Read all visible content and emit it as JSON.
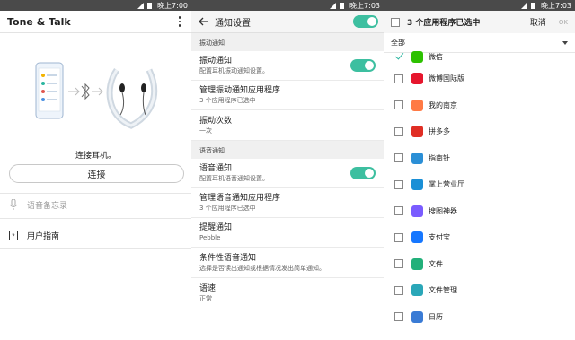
{
  "status_bars": [
    {
      "time": "晚上7:00"
    },
    {
      "time": "晚上7:03"
    },
    {
      "time": "晚上7:03"
    }
  ],
  "panel1": {
    "title": "Tone & Talk",
    "connect_prompt": "连接耳机。",
    "connect_button": "连接",
    "rows": [
      {
        "label": "语音备忘录",
        "icon": "microphone-hand-icon",
        "enabled": false
      },
      {
        "label": "用户指南",
        "icon": "help-book-icon",
        "enabled": true
      }
    ]
  },
  "panel2": {
    "title": "通知设置",
    "header_toggle": "on",
    "sections": [
      {
        "header": "振动通知",
        "items": [
          {
            "title": "振动通知",
            "subtitle": "配置耳机振动通知设置。",
            "toggle": "on"
          },
          {
            "title": "管理振动通知应用程序",
            "subtitle": "3 个应用程序已选中"
          },
          {
            "title": "振动次数",
            "subtitle": "一次"
          }
        ]
      },
      {
        "header": "语音通知",
        "items": [
          {
            "title": "语音通知",
            "subtitle": "配置耳机语音通知设置。",
            "toggle": "on"
          },
          {
            "title": "管理语音通知应用程序",
            "subtitle": "3 个应用程序已选中"
          },
          {
            "title": "提醒通知",
            "subtitle": "Pebble"
          },
          {
            "title": "条件性语音通知",
            "subtitle": "选择是否读出通知或根据情况发出简单通知。"
          },
          {
            "title": "语速",
            "subtitle": "正常"
          }
        ]
      }
    ]
  },
  "panel3": {
    "title": "3 个应用程序已选中",
    "cancel": "取消",
    "ok": "OK",
    "filter": "全部",
    "apps": [
      {
        "name": "微信",
        "checked": true,
        "icon": "wechat-icon",
        "color": "#2dc100"
      },
      {
        "name": "微博国际版",
        "checked": false,
        "icon": "weibo-icon",
        "color": "#e6162d"
      },
      {
        "name": "我的南京",
        "checked": false,
        "icon": "my-nanjing-icon",
        "color": "#ff7a45"
      },
      {
        "name": "拼多多",
        "checked": false,
        "icon": "pinduoduo-icon",
        "color": "#e02e24"
      },
      {
        "name": "指南针",
        "checked": false,
        "icon": "compass-icon",
        "color": "#2b8fd6"
      },
      {
        "name": "掌上营业厅",
        "checked": false,
        "icon": "mobile-hall-icon",
        "color": "#1a8fd6"
      },
      {
        "name": "搜图神器",
        "checked": false,
        "icon": "image-search-icon",
        "color": "#7a5cff"
      },
      {
        "name": "支付宝",
        "checked": false,
        "icon": "alipay-icon",
        "color": "#1677ff"
      },
      {
        "name": "文件",
        "checked": false,
        "icon": "files-icon",
        "color": "#22b07a"
      },
      {
        "name": "文件管理",
        "checked": false,
        "icon": "file-manager-icon",
        "color": "#2aa7b8"
      },
      {
        "name": "日历",
        "checked": false,
        "icon": "calendar-icon",
        "color": "#3a7bd5"
      }
    ]
  },
  "colors": {
    "accent": "#3dbfa0",
    "statusbar": "#4a4a4a"
  }
}
